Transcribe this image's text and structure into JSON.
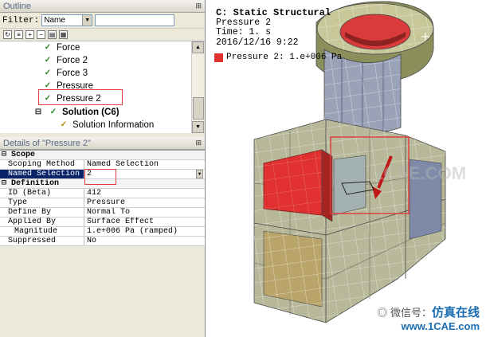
{
  "outline": {
    "title": "Outline",
    "filter_label": "Filter:",
    "filter_value": "Name",
    "tree": [
      {
        "label": "Force",
        "icon": "force-icon"
      },
      {
        "label": "Force 2",
        "icon": "force-icon"
      },
      {
        "label": "Force 3",
        "icon": "force-icon"
      },
      {
        "label": "Pressure",
        "icon": "pressure-icon"
      },
      {
        "label": "Pressure 2",
        "icon": "pressure-icon"
      },
      {
        "label": "Solution (C6)",
        "icon": "solution-icon"
      },
      {
        "label": "Solution Information",
        "icon": "info-icon"
      }
    ]
  },
  "details": {
    "title": "Details of \"Pressure 2\"",
    "sections": [
      {
        "name": "Scope",
        "rows": [
          {
            "key": "Scoping Method",
            "value": "Named Selection"
          },
          {
            "key": "Named Selection",
            "value": "2"
          }
        ]
      },
      {
        "name": "Definition",
        "rows": [
          {
            "key": "ID (Beta)",
            "value": "412"
          },
          {
            "key": "Type",
            "value": "Pressure"
          },
          {
            "key": "Define By",
            "value": "Normal To"
          },
          {
            "key": "Applied By",
            "value": "Surface Effect"
          },
          {
            "key": "Magnitude",
            "value": "1.e+006 Pa  (ramped)"
          },
          {
            "key": "Suppressed",
            "value": "No"
          }
        ]
      }
    ]
  },
  "viewport": {
    "title": "C: Static Structural",
    "subtitle": "Pressure 2",
    "time": "Time: 1. s",
    "date": "2016/12/16 9:22",
    "legend": "Pressure 2: 1.e+006 Pa",
    "legend_color": "#e03030"
  },
  "watermark": {
    "wechat": "微信号：",
    "brand": "仿真在线",
    "site": "www.1CAE.com",
    "center": "1CAE.COM"
  }
}
